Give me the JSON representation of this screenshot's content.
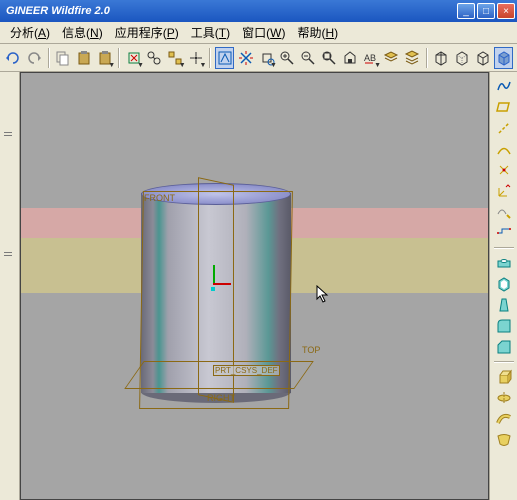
{
  "window": {
    "title": "GINEER Wildfire 2.0",
    "min_tip": "Minimize",
    "max_tip": "Maximize",
    "close_tip": "Close"
  },
  "menu": {
    "items": [
      {
        "label": "分析",
        "key": "A"
      },
      {
        "label": "信息",
        "key": "N"
      },
      {
        "label": "应用程序",
        "key": "P"
      },
      {
        "label": "工具",
        "key": "T"
      },
      {
        "label": "窗口",
        "key": "W"
      },
      {
        "label": "帮助",
        "key": "H"
      }
    ]
  },
  "toolbar": {
    "undo": "undo",
    "redo": "redo",
    "copy": "copy",
    "paste": "paste",
    "paste_special": "paste-special",
    "regen": "regenerate",
    "find": "find",
    "select": "select-arrow",
    "sketch": "sketch-toggle",
    "spin": "spin-center",
    "orient": "orient",
    "zoom_in": "zoom-in",
    "zoom_out": "zoom-out",
    "refit": "refit",
    "repaint": "repaint",
    "annotate": "annotation",
    "layers": "layers",
    "layers2": "layers-stack",
    "wireframe": "wireframe",
    "hidden": "hidden-line",
    "no_hidden": "no-hidden",
    "shaded": "shaded"
  },
  "right_tools": {
    "line_wave": "sketch-spline",
    "plane": "datum-plane",
    "axis": "datum-axis",
    "curve": "datum-curve",
    "point": "datum-point",
    "csys": "coord-sys",
    "sketch": "sketched-curve",
    "analysis": "analysis-feature",
    "hole": "hole-tool",
    "shell": "shell-tool",
    "draft": "draft-tool",
    "round": "round-tool",
    "chamfer": "chamfer-tool",
    "extrude": "extrude-tool",
    "revolve": "revolve-tool",
    "sweep": "sweep-tool",
    "blend": "blend-tool"
  },
  "model": {
    "datum_front": "FRONT",
    "datum_top": "TOP",
    "datum_right": "RIGHT",
    "csys_name": "PRT_CSYS_DEF"
  },
  "colors": {
    "titlebar": "#2a62c8",
    "datum": "#8b6914",
    "canvas": "#a5a5a5"
  }
}
